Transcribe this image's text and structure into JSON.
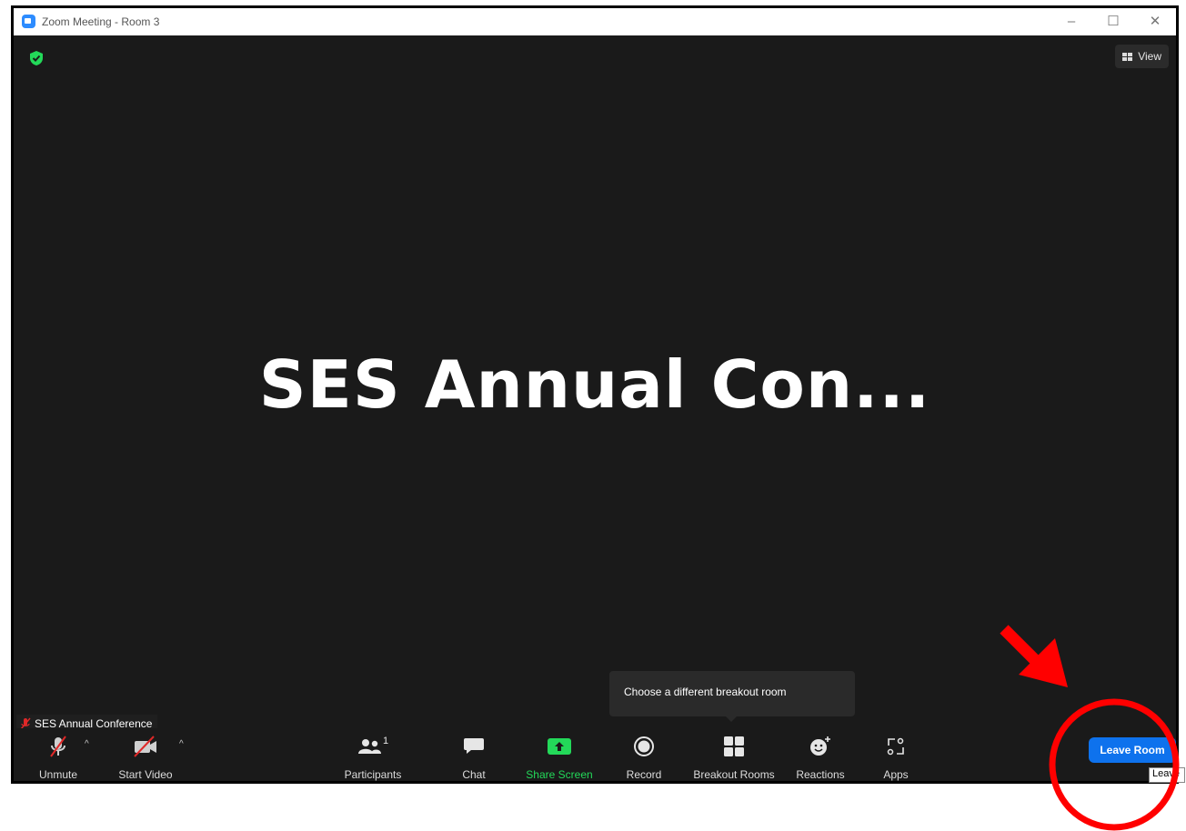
{
  "window": {
    "title": "Zoom Meeting - Room 3",
    "controls": {
      "minimize": "–",
      "maximize": "☐",
      "close": "✕"
    }
  },
  "header": {
    "view_label": "View"
  },
  "main": {
    "shared_title": "SES Annual Con..."
  },
  "participant_tag": {
    "name": "SES Annual Conference"
  },
  "tooltip": {
    "text": "Choose a different breakout room"
  },
  "toolbar": {
    "unmute": "Unmute",
    "start_video": "Start Video",
    "participants": "Participants",
    "participants_count": "1",
    "chat": "Chat",
    "share_screen": "Share Screen",
    "record": "Record",
    "breakout_rooms": "Breakout Rooms",
    "reactions": "Reactions",
    "apps": "Apps",
    "caret": "^"
  },
  "leave": {
    "button_label": "Leave Room",
    "tooltip": "Leave"
  },
  "colors": {
    "share_green": "#23d959",
    "leave_blue": "#0e72ed",
    "annotation_red": "#ff0000"
  },
  "icons": [
    "shield-icon",
    "grid-icon",
    "mic-muted-icon",
    "video-off-icon",
    "participants-icon",
    "chat-icon",
    "share-screen-icon",
    "record-icon",
    "breakout-rooms-icon",
    "reactions-icon",
    "apps-icon"
  ]
}
